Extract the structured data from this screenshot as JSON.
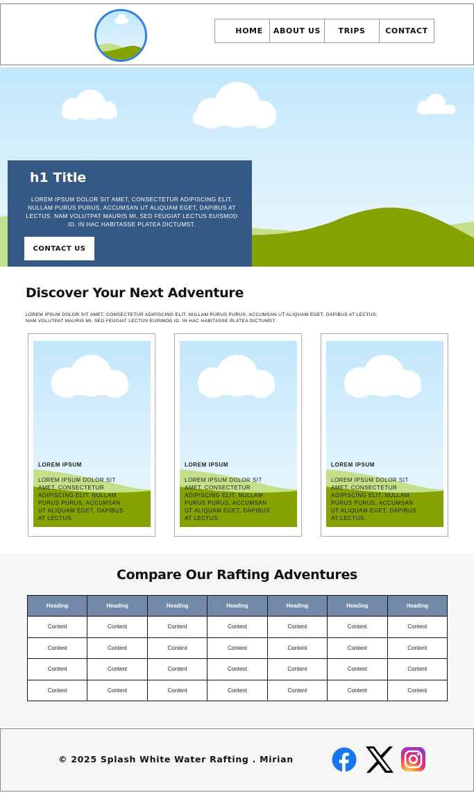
{
  "nav": {
    "items": [
      "HOME",
      "ABOUT US",
      "TRIPS",
      "CONTACT"
    ]
  },
  "hero": {
    "title": "h1 Title",
    "text": "LOREM IPSUM DOLOR SIT AMET, CONSECTETUR ADIPISCING ELIT. NULLAM PURUS PURUS, ACCUMSAN UT ALIQUAM EGET, DAPIBUS AT LECTUS. NAM VOLUTPAT MAURIS MI, SED FEUGIAT LECTUS EUISMOD ID. IN HAC HABITASSE PLATEA DICTUMST.",
    "button_label": "CONTACT US"
  },
  "discover": {
    "title": "Discover Your Next Adventure",
    "text": "LOREM IPSUM DOLOR SIT AMET, CONSECTETUR ADIPISCING ELIT. NULLAM PURUS PURUS, ACCUMSAN UT ALIQUAM EGET, DAPIBUS AT LECTUS. NAM VOLUTPAT MAURIS MI, SED FEUGIAT LECTUS EUISMOD ID. IN HAC HABITASSE PLATEA DICTUMST.",
    "cards": [
      {
        "title": "LOREM IPSUM",
        "text": "LOREM IPSUM DOLOR SIT AMET, CONSECTETUR ADIPISCING ELIT. NULLAM PURUS PURUS, ACCUMSAN UT ALIQUAM EGET, DAPIBUS AT LECTUS."
      },
      {
        "title": "LOREM IPSUM",
        "text": "LOREM IPSUM DOLOR SIT AMET, CONSECTETUR ADIPISCING ELIT. NULLAM PURUS PURUS, ACCUMSAN UT ALIQUAM EGET, DAPIBUS AT LECTUS."
      },
      {
        "title": "LOREM IPSUM",
        "text": "LOREM IPSUM DOLOR SIT AMET, CONSECTETUR ADIPISCING ELIT. NULLAM PURUS PURUS, ACCUMSAN UT ALIQUAM EGET, DAPIBUS AT LECTUS."
      }
    ]
  },
  "compare": {
    "title": "Compare Our Rafting Adventures",
    "headers": [
      "Heading",
      "Heading",
      "Heading",
      "Heading",
      "Heading",
      "Heading",
      "Heading"
    ],
    "rows": [
      [
        "Content",
        "Content",
        "Content",
        "Content",
        "Content",
        "Content",
        "Content"
      ],
      [
        "Content",
        "Content",
        "Content",
        "Content",
        "Content",
        "Content",
        "Content"
      ],
      [
        "Content",
        "Content",
        "Content",
        "Content",
        "Content",
        "Content",
        "Content"
      ],
      [
        "Content",
        "Content",
        "Content",
        "Content",
        "Content",
        "Content",
        "Content"
      ]
    ]
  },
  "footer": {
    "copyright": "© 2025 Splash White Water Rafting . Mirian",
    "social_icons": [
      "facebook-icon",
      "x-icon",
      "instagram-icon"
    ]
  },
  "colors": {
    "logo_ring": "#2f7fe0",
    "hero_box": "#355985",
    "table_header": "#7289aa",
    "sky": "#c9e9fb",
    "hill_dark": "#85a300",
    "hill_light": "#c5e08a",
    "facebook": "#1877f2"
  }
}
